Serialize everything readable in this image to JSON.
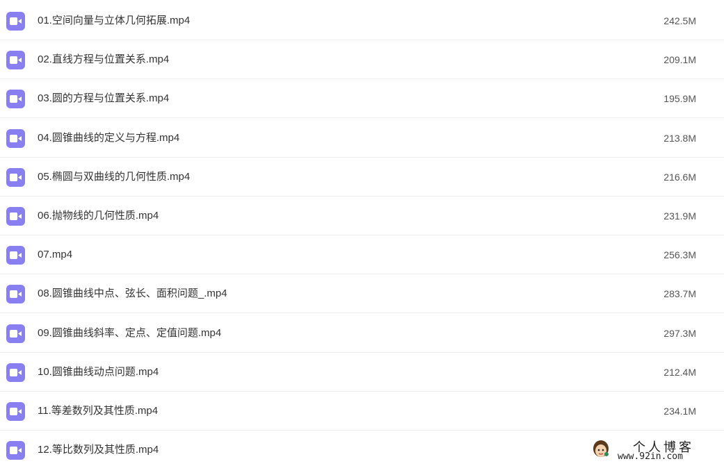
{
  "files": [
    {
      "name": "01.空间向量与立体几何拓展.mp4",
      "size": "242.5M",
      "icon": "video-file-icon"
    },
    {
      "name": "02.直线方程与位置关系.mp4",
      "size": "209.1M",
      "icon": "video-file-icon"
    },
    {
      "name": "03.圆的方程与位置关系.mp4",
      "size": "195.9M",
      "icon": "video-file-icon"
    },
    {
      "name": "04.圆锥曲线的定义与方程.mp4",
      "size": "213.8M",
      "icon": "video-file-icon"
    },
    {
      "name": "05.椭圆与双曲线的几何性质.mp4",
      "size": "216.6M",
      "icon": "video-file-icon"
    },
    {
      "name": "06.抛物线的几何性质.mp4",
      "size": "231.9M",
      "icon": "video-file-icon"
    },
    {
      "name": "07.mp4",
      "size": "256.3M",
      "icon": "video-file-icon"
    },
    {
      "name": "08.圆锥曲线中点、弦长、面积问题_.mp4",
      "size": "283.7M",
      "icon": "video-file-icon"
    },
    {
      "name": "09.圆锥曲线斜率、定点、定值问题.mp4",
      "size": "297.3M",
      "icon": "video-file-icon"
    },
    {
      "name": "10.圆锥曲线动点问题.mp4",
      "size": "212.4M",
      "icon": "video-file-icon"
    },
    {
      "name": "11.等差数列及其性质.mp4",
      "size": "234.1M",
      "icon": "video-file-icon"
    },
    {
      "name": "12.等比数列及其性质.mp4",
      "size": "",
      "icon": "video-file-icon"
    }
  ],
  "watermark": {
    "title": "个人博客",
    "url": "www.92in.com"
  },
  "colors": {
    "icon_background": "#8a7ff0",
    "text": "#333333",
    "divider": "#f0f0f2"
  }
}
